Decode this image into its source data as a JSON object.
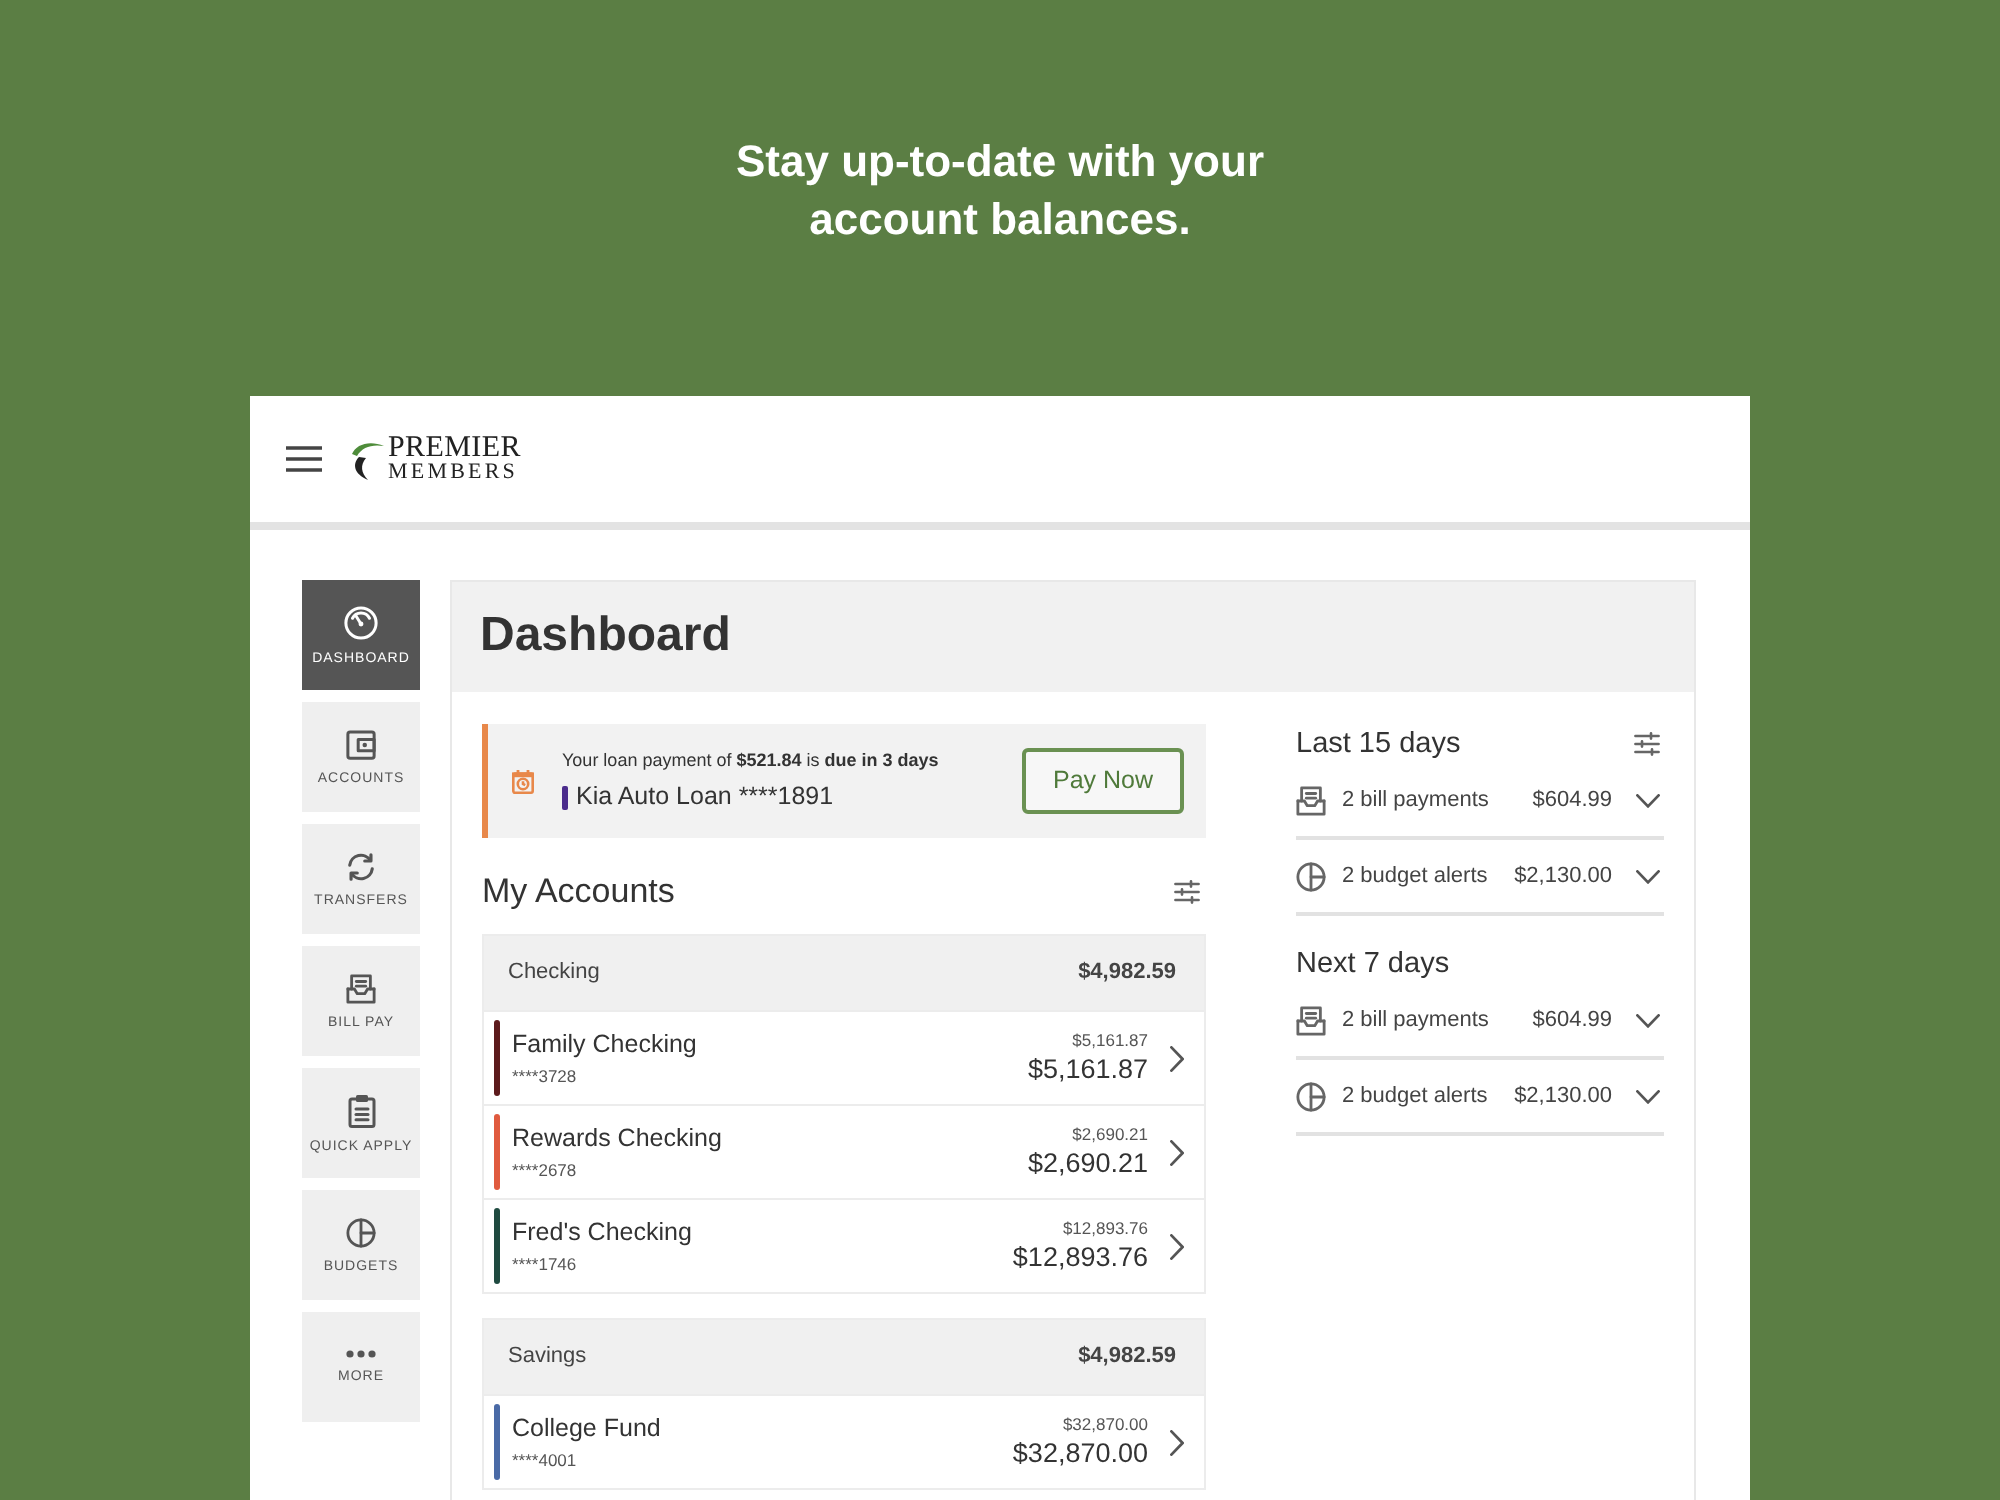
{
  "headline": "Stay up-to-date with your account balances.",
  "header": {
    "logo": {
      "line_1": "PREMIER",
      "line_2": "MEMBERS"
    }
  },
  "sidebar": {
    "items": [
      {
        "label": "DASHBOARD",
        "kind": "dashboard",
        "selected": true
      },
      {
        "label": "ACCOUNTS",
        "kind": "accounts",
        "selected": false
      },
      {
        "label": "TRANSFERS",
        "kind": "transfers",
        "selected": false
      },
      {
        "label": "BILL PAY",
        "kind": "bill_pay",
        "selected": false
      },
      {
        "label": "QUICK APPLY",
        "kind": "quick_apply",
        "selected": false
      },
      {
        "label": "BUDGETS",
        "kind": "budgets",
        "selected": false
      },
      {
        "label": "MORE",
        "kind": "more",
        "selected": false
      }
    ]
  },
  "page_title": "Dashboard",
  "alert": {
    "message": "Your loan payment of **$521.84** is **due in 3 days**",
    "loan": {
      "name": "Kia Auto Loan ****1891",
      "color": "#4b2c8c"
    },
    "button": "Pay Now"
  },
  "accounts": {
    "title": "My Accounts",
    "groups": [
      {
        "name": "Checking",
        "total": "$4,982.59",
        "accounts": [
          {
            "name": "Family Checking",
            "number": "****3728",
            "available": "$5,161.87",
            "balance": "$5,161.87",
            "color": "#5c1a1c"
          },
          {
            "name": "Rewards Checking",
            "number": "****2678",
            "available": "$2,690.21",
            "balance": "$2,690.21",
            "color": "#e05a3e"
          },
          {
            "name": "Fred's Checking",
            "number": "****1746",
            "available": "$12,893.76",
            "balance": "$12,893.76",
            "color": "#1f4a40"
          }
        ]
      },
      {
        "name": "Savings",
        "total": "$4,982.59",
        "accounts": [
          {
            "name": "College Fund",
            "number": "****4001",
            "available": "$32,870.00",
            "balance": "$32,870.00",
            "color": "#4a6aa6"
          }
        ]
      }
    ]
  },
  "activity": {
    "sections": [
      {
        "title": "Last 15 days",
        "filter": true,
        "rows": [
          {
            "kind": "bill",
            "label": "2 bill payments",
            "amount": "$604.99",
            "expanded": false
          },
          {
            "kind": "budget",
            "label": "2 budget alerts",
            "amount": "$2,130.00",
            "expanded": false
          }
        ]
      },
      {
        "title": "Next 7 days",
        "filter": false,
        "rows": [
          {
            "kind": "bill",
            "label": "2 bill payments",
            "amount": "$604.99",
            "expanded": false
          },
          {
            "kind": "budget",
            "label": "2 budget alerts",
            "amount": "$2,130.00",
            "expanded": false
          }
        ]
      }
    ]
  }
}
